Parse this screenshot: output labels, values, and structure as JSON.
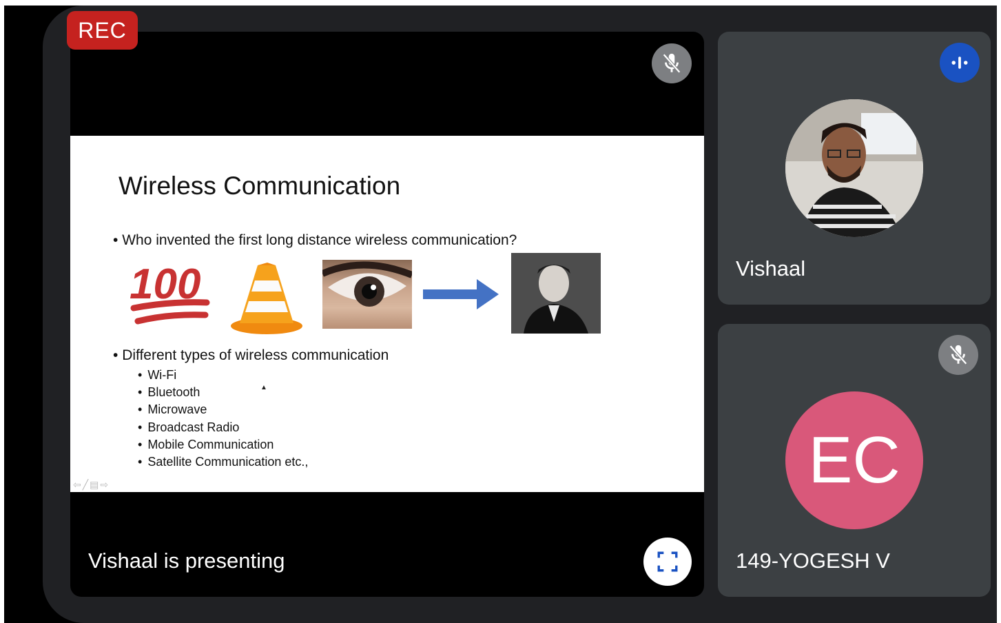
{
  "recording_badge": "REC",
  "main": {
    "status_text": "Vishaal is presenting",
    "slide": {
      "title": "Wireless Communication",
      "bullet_1": "Who invented the first long distance wireless communication?",
      "emoji_text": "100",
      "bullet_2": "Different types of wireless communication",
      "sub_items": [
        "Wi-Fi",
        "Bluetooth",
        "Microwave",
        "Broadcast Radio",
        "Mobile Communication",
        "Satellite Communication etc.,"
      ]
    }
  },
  "participants": [
    {
      "name": "Vishaal",
      "state": "speaking",
      "avatar": "photo"
    },
    {
      "name": "149-YOGESH V",
      "state": "muted",
      "initials": "EC",
      "avatar_color": "#d9587a"
    }
  ],
  "colors": {
    "rec": "#c5221f",
    "speaking": "#1a52c2",
    "tile_bg": "#3c4043",
    "meet_bg": "#202124"
  },
  "icons": {
    "main_mute": "mic-off-icon",
    "fullscreen": "fullscreen-icon",
    "speaking": "audio-level-icon",
    "side_mute": "mic-off-icon"
  }
}
